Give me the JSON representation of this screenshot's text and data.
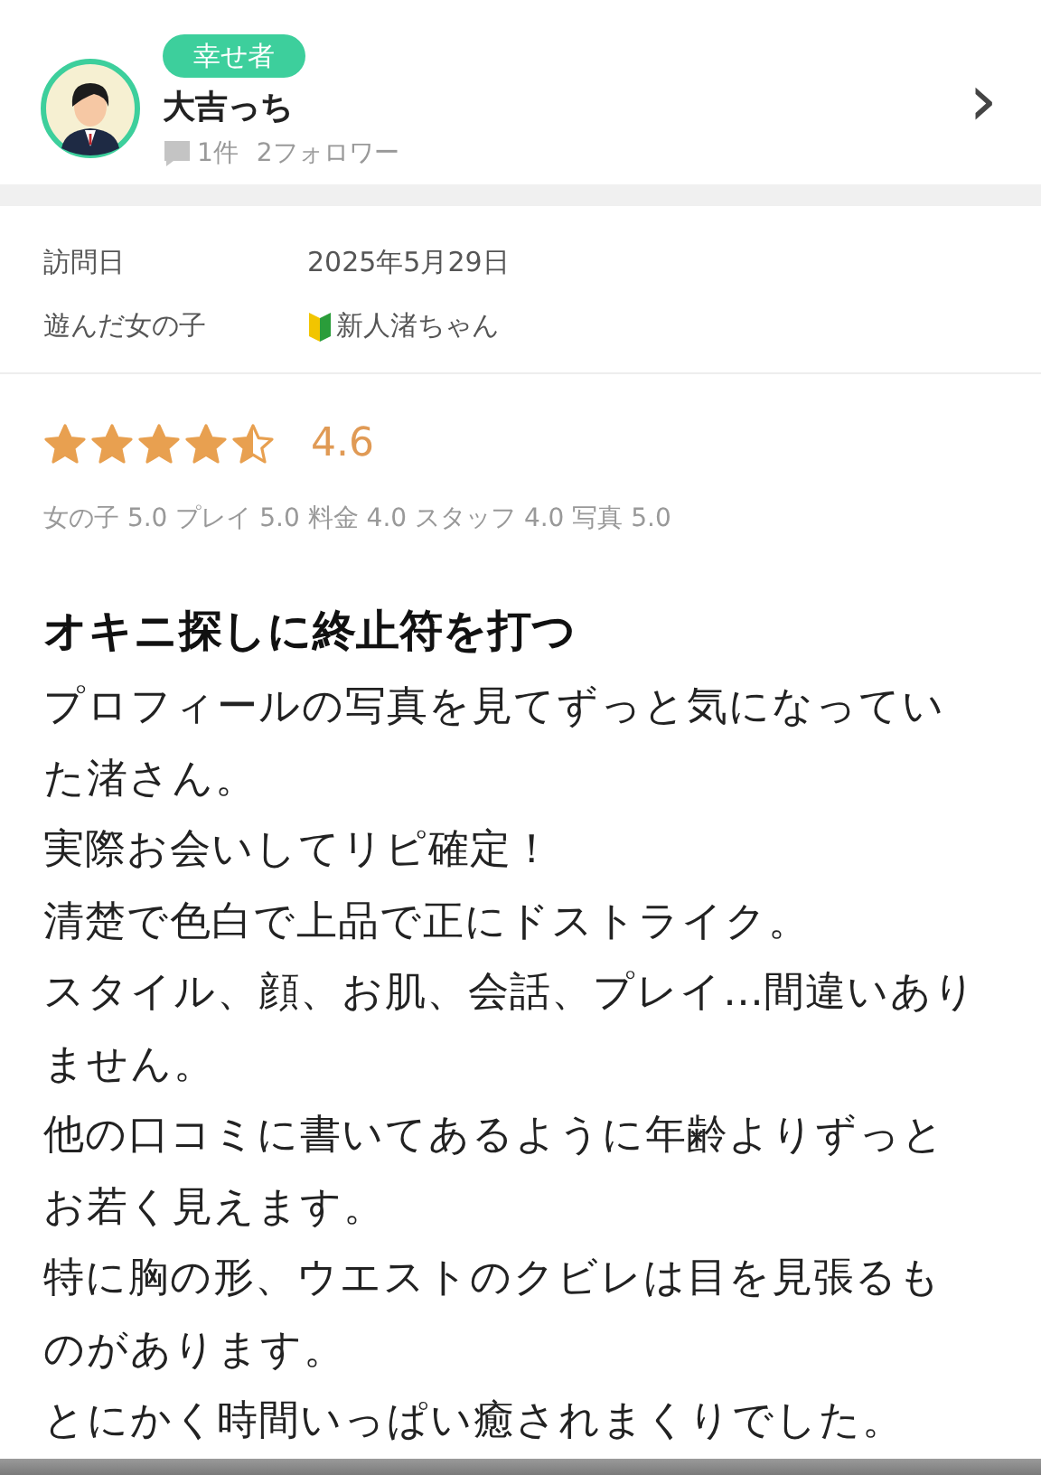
{
  "user": {
    "badge": "幸せ者",
    "name": "大吉っち",
    "review_count": "1件",
    "followers": "2フォロワー",
    "chevron": "›"
  },
  "visit": [
    {
      "label": "訪問日",
      "value": "2025年5月29日",
      "beginner": false
    },
    {
      "label": "遊んだ女の子",
      "value": "新人渚ちゃん",
      "beginner": true
    }
  ],
  "rating": {
    "stars": 4.5,
    "score": "4.6",
    "breakdown": "女の子 5.0 プレイ 5.0 料金 4.0 スタッフ 4.0 写真 5.0"
  },
  "review": {
    "title": "オキニ探しに終止符を打つ",
    "paragraphs": [
      "プロフィールの写真を見てずっと気になっていた渚さん。",
      "実際お会いしてリピ確定！",
      "清楚で色白で上品で正にドストライク。",
      "スタイル、顔、お肌、会話、プレイ…間違いありません。",
      "他の口コミに書いてあるように年齢よりずっとお若く見えます。",
      "特に胸の形、ウエストのクビレは目を見張るものがあります。",
      "とにかく時間いっぱい癒されまくりでした。"
    ]
  }
}
